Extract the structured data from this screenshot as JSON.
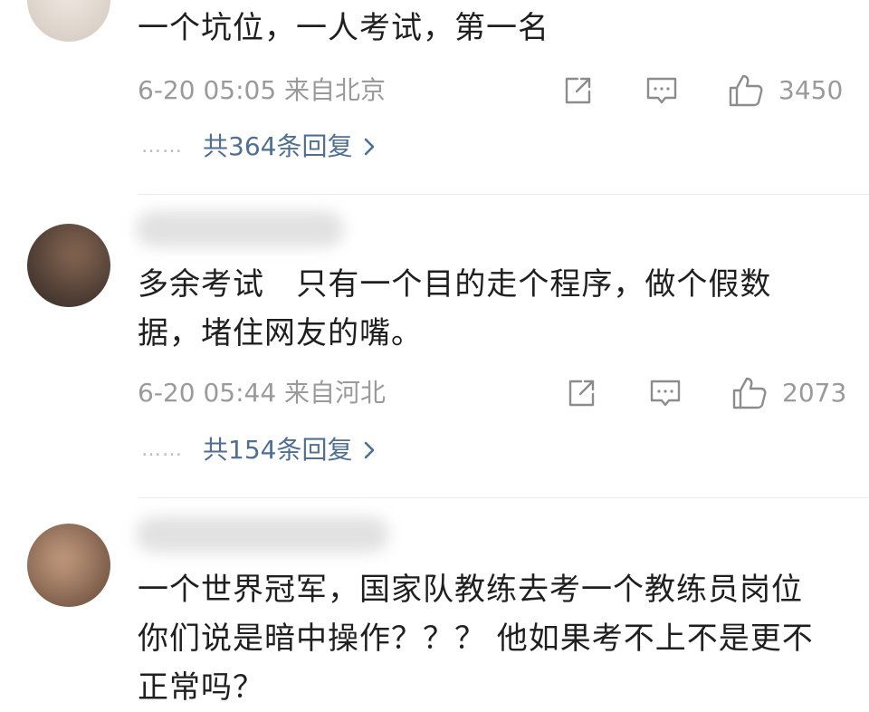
{
  "comments": [
    {
      "text": "一个坑位，一人考试，第一名",
      "time_location": "6-20 05:05  来自北京",
      "like_count": "3450",
      "replies_label": "共364条回复",
      "dots": "……"
    },
    {
      "text": "多余考试   只有一个目的走个程序，做个假数\n据，堵住网友的嘴。",
      "time_location": "6-20 05:44  来自河北",
      "like_count": "2073",
      "replies_label": "共154条回复",
      "dots": "……"
    },
    {
      "text": "一个世界冠军，国家队教练去考一个教练员岗位\n你们说是暗中操作？？？ 他如果考不上不是更不\n正常吗？",
      "time_location": "",
      "like_count": "",
      "replies_label": "",
      "dots": ""
    }
  ],
  "colors": {
    "meta_text": "#9a9a9a",
    "reply_link": "#4f6f93",
    "icon": "#8c8c8c"
  },
  "icons": {
    "share": "share-icon",
    "comment": "comment-icon",
    "like": "thumbs-up-icon",
    "chevron": "chevron-right-icon"
  }
}
